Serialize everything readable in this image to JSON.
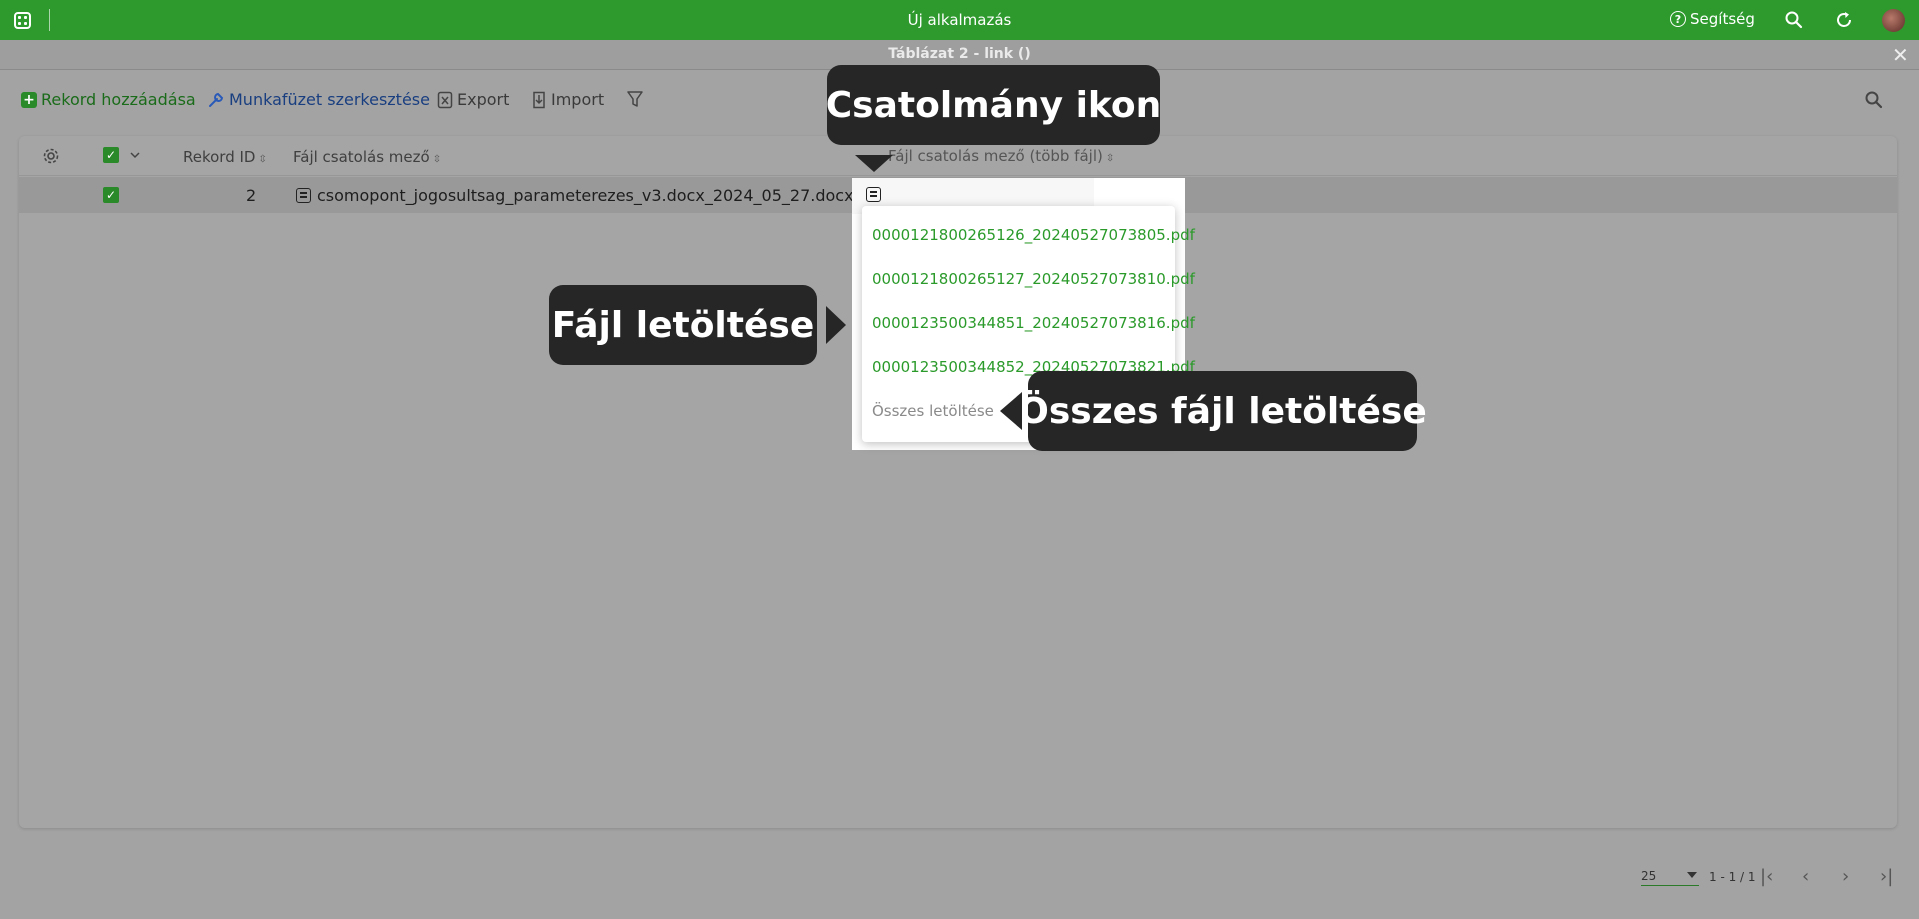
{
  "topbar": {
    "title": "Új alkalmazás",
    "help_label": "Segítség",
    "accent_color": "#2e9a2e"
  },
  "subheader": {
    "title": "Táblázat 2 - link ()"
  },
  "toolbar": {
    "add_record": "Rekord hozzáadása",
    "edit_workbook": "Munkafüzet szerkesztése",
    "export": "Export",
    "import": "Import"
  },
  "table": {
    "headers": {
      "record_id": "Rekord ID",
      "file_field": "Fájl csatolás mező",
      "multi_file_field": "Fájl csatolás mező (több fájl)"
    },
    "rows": [
      {
        "record_id": "2",
        "file": "csomopont_jogosultsag_parameterezes_v3.docx_2024_05_27.docx"
      }
    ]
  },
  "dropdown": {
    "files": [
      "0000121800265126_20240527073805.pdf",
      "0000121800265127_20240527073810.pdf",
      "0000123500344851_20240527073816.pdf",
      "0000123500344852_20240527073821.pdf"
    ],
    "download_all": "Összes letöltése"
  },
  "callouts": {
    "attachment_icon": "Csatolmány ikon",
    "download_file": "Fájl letöltése",
    "download_all_files": "Összes fájl letöltése"
  },
  "footer": {
    "page_size": "25",
    "page_info": "1 - 1 / 1"
  }
}
